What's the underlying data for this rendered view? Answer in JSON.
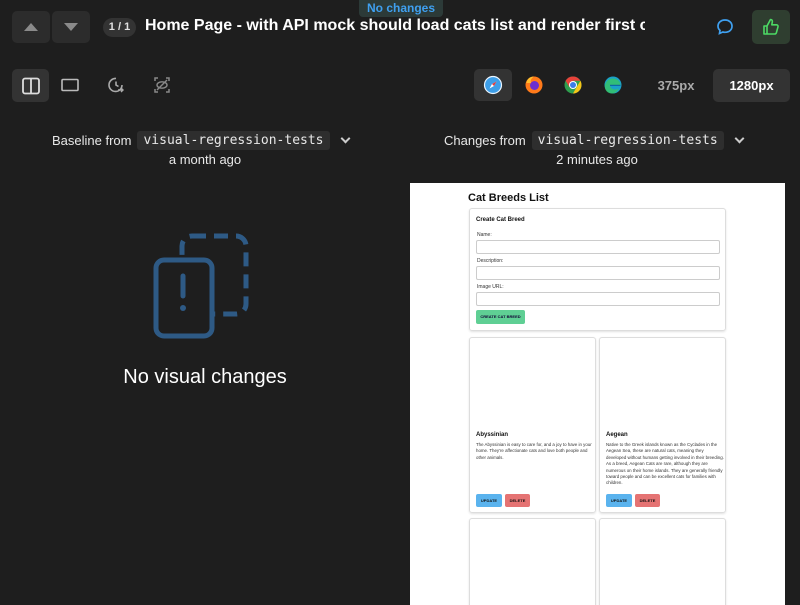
{
  "status": {
    "label": "No changes",
    "color": "#3fa0f0"
  },
  "header": {
    "counter": "1 / 1",
    "title": "Home Page - with API mock should load cats list and render first card co...",
    "nav_up_icon": "chevron-up-icon",
    "nav_down_icon": "chevron-down-icon",
    "comment_icon": "comment-icon",
    "approve_icon": "thumbs-up-icon",
    "approve_color": "#4cd964"
  },
  "toolbar": {
    "tools": [
      "split-view-icon",
      "single-view-icon",
      "history-icon",
      "ignore-region-icon"
    ],
    "browsers": [
      "safari-icon",
      "firefox-icon",
      "chrome-icon",
      "edge-icon"
    ],
    "widths": [
      "375px",
      "1280px"
    ]
  },
  "baseline": {
    "prefix": "Baseline from",
    "branch": "visual-regression-tests",
    "time": "a month ago"
  },
  "changes": {
    "prefix": "Changes from",
    "branch": "visual-regression-tests",
    "time": "2 minutes ago"
  },
  "empty_state": {
    "icon": "no-changes-icon",
    "text": "No visual changes"
  },
  "preview": {
    "title": "Cat Breeds List",
    "form": {
      "title": "Create Cat Breed",
      "name_label": "Name:",
      "description_label": "Description:",
      "image_label": "Image URL:",
      "submit": "CREATE CAT BREED"
    },
    "cards": [
      {
        "name": "Abyssinian",
        "description": "The Abyssinian is easy to care for, and a joy to have in your home. They're affectionate cats and love both people and other animals.",
        "update": "UPDATE",
        "delete": "DELETE"
      },
      {
        "name": "Aegean",
        "description": "Native to the Greek islands known as the Cyclades in the Aegean Sea, these are natural cats, meaning they developed without humans getting involved in their breeding. As a breed, Aegean Cats are rare, although they are numerous on their home islands. They are generally friendly toward people and can be excellent cats for families with children.",
        "update": "UPDATE",
        "delete": "DELETE"
      }
    ]
  }
}
